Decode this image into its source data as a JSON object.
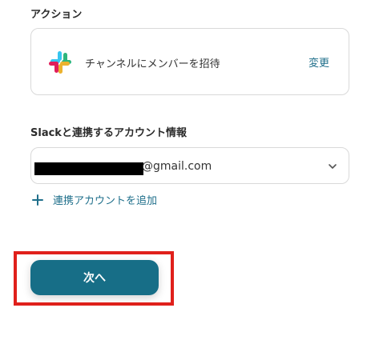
{
  "action": {
    "section_label": "アクション",
    "icon": "slack-icon",
    "name": "チャンネルにメンバーを招待",
    "change_label": "変更"
  },
  "account": {
    "section_label": "Slackと連携するアカウント情報",
    "selected_value": "@gmail.com",
    "add_account_label": "連携アカウントを追加"
  },
  "footer": {
    "next_label": "次へ"
  },
  "colors": {
    "accent": "#176e87",
    "link": "#1f6f8b",
    "highlight": "#e0201b"
  }
}
